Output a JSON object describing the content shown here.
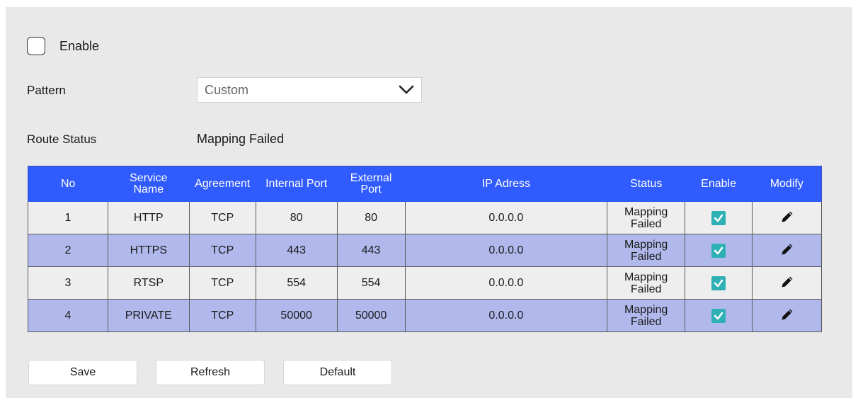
{
  "enable": {
    "label": "Enable",
    "checked": false
  },
  "pattern": {
    "label": "Pattern",
    "value": "Custom"
  },
  "route_status": {
    "label": "Route Status",
    "value": "Mapping Failed"
  },
  "table": {
    "headers": {
      "no": "No",
      "service_name_1": "Service",
      "service_name_2": "Name",
      "agreement": "Agreement",
      "internal_port": "Internal Port",
      "external_port_1": "External",
      "external_port_2": "Port",
      "ip_address": "IP Adress",
      "status": "Status",
      "enable": "Enable",
      "modify": "Modify"
    },
    "rows": [
      {
        "no": "1",
        "service": "HTTP",
        "agreement": "TCP",
        "internal": "80",
        "external": "80",
        "ip": "0.0.0.0",
        "status_1": "Mapping",
        "status_2": "Failed",
        "enabled": true
      },
      {
        "no": "2",
        "service": "HTTPS",
        "agreement": "TCP",
        "internal": "443",
        "external": "443",
        "ip": "0.0.0.0",
        "status_1": "Mapping",
        "status_2": "Failed",
        "enabled": true
      },
      {
        "no": "3",
        "service": "RTSP",
        "agreement": "TCP",
        "internal": "554",
        "external": "554",
        "ip": "0.0.0.0",
        "status_1": "Mapping",
        "status_2": "Failed",
        "enabled": true
      },
      {
        "no": "4",
        "service": "PRIVATE",
        "agreement": "TCP",
        "internal": "50000",
        "external": "50000",
        "ip": "0.0.0.0",
        "status_1": "Mapping",
        "status_2": "Failed",
        "enabled": true
      }
    ]
  },
  "buttons": {
    "save": "Save",
    "refresh": "Refresh",
    "default": "Default"
  },
  "icons": {
    "enable_check": "checkmark-icon",
    "modify": "pencil-icon",
    "dropdown": "chevron-down-icon"
  },
  "colors": {
    "header": "#2f5bff",
    "row_alt": "#b1b9ec",
    "check": "#2fb0b4"
  }
}
